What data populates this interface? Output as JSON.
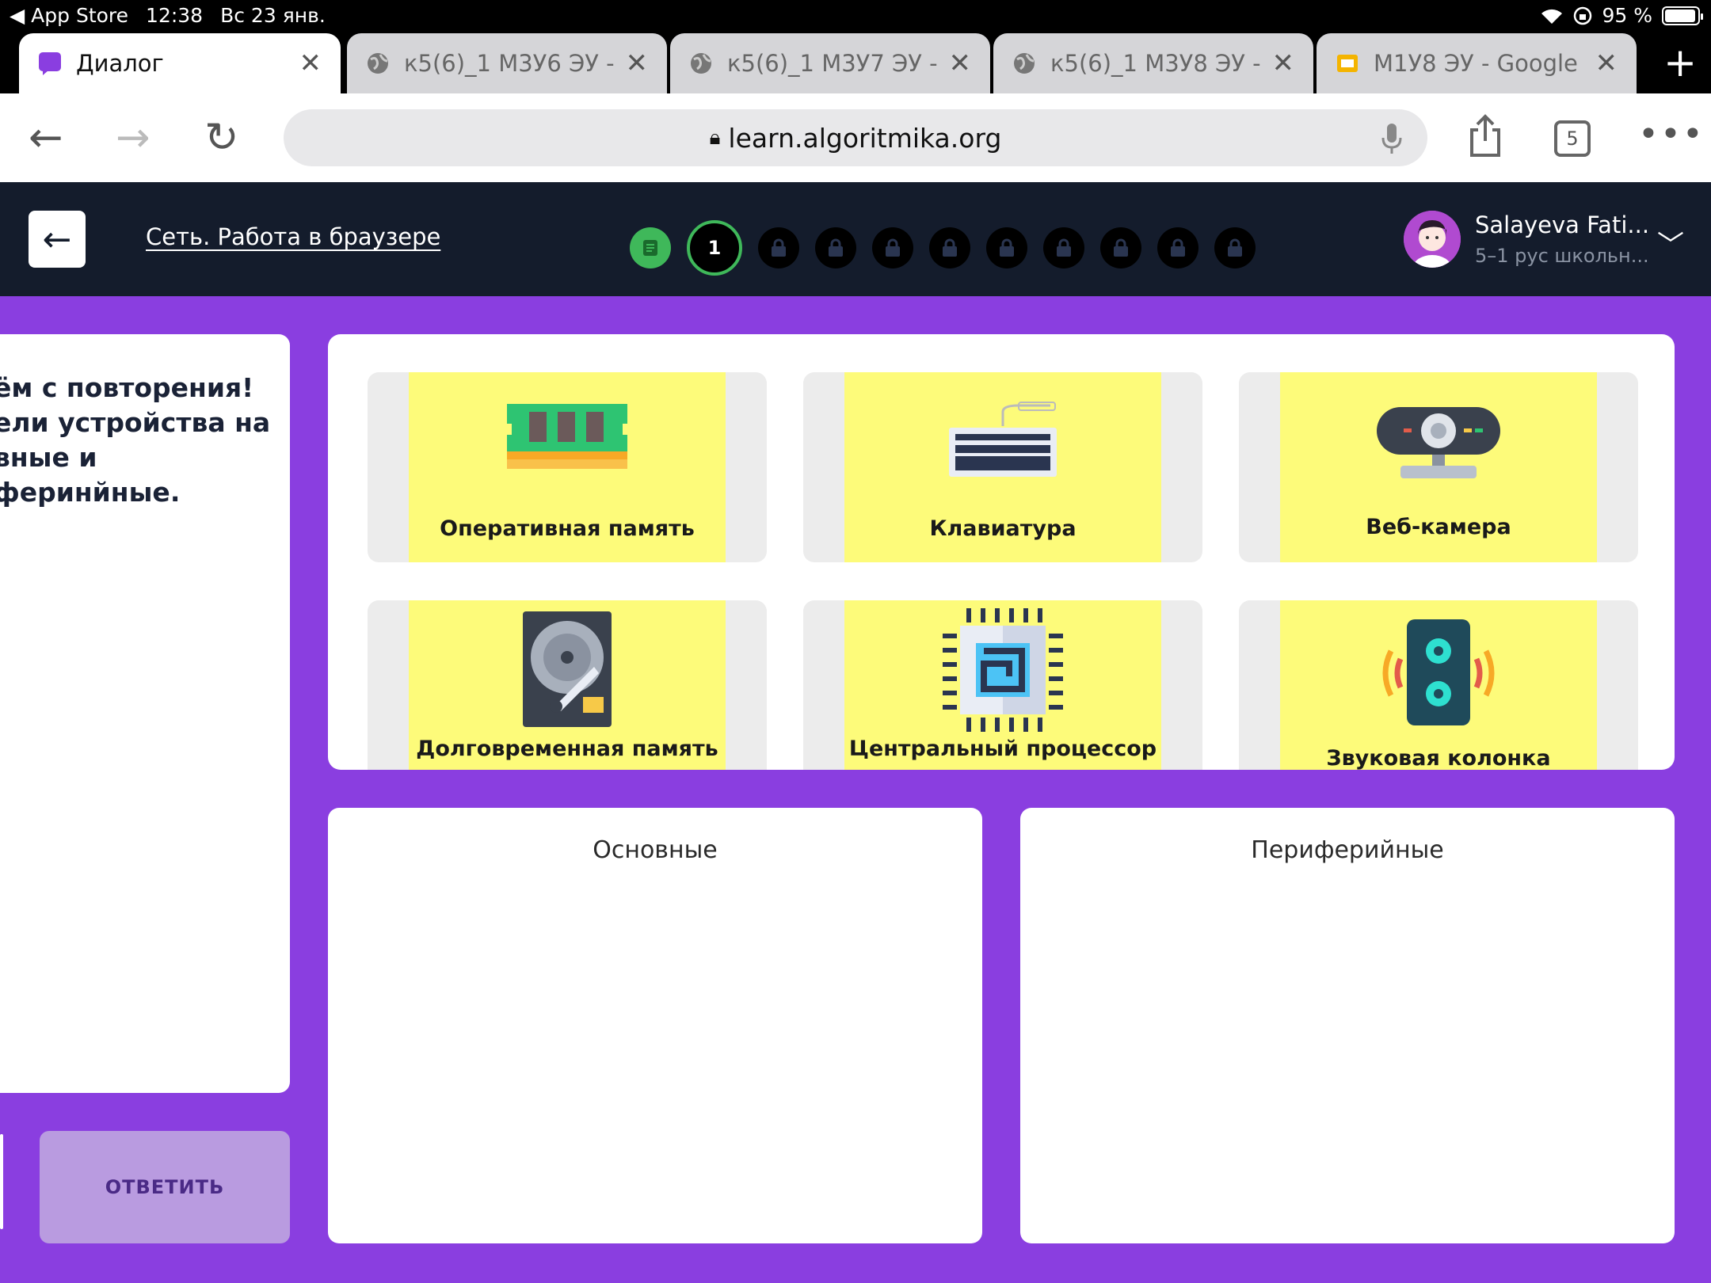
{
  "status": {
    "back_app": "◀ App Store",
    "time": "12:38",
    "date": "Вс 23 янв.",
    "battery": "95 %"
  },
  "tabs": [
    {
      "title": "Диалог",
      "active": true
    },
    {
      "title": "к5(6)_1 М3У6 ЭУ - С"
    },
    {
      "title": "к5(6)_1 М3У7 ЭУ - С"
    },
    {
      "title": "к5(6)_1 М3У8 ЭУ - С"
    },
    {
      "title": "М1У8 ЭУ - Google П"
    }
  ],
  "browser": {
    "url": "learn.algoritmika.org",
    "tab_count": "5"
  },
  "header": {
    "course": "Сеть. Работа в браузере",
    "current_step": "1",
    "user_name": "Salayeva Fati...",
    "user_group": "5–1 рус школьн..."
  },
  "question": {
    "lines": [
      "ём с повторения!",
      "ели устройства на",
      "вные и",
      "феринйные."
    ]
  },
  "answer_label": "ОТВЕТИТЬ",
  "cards": [
    {
      "label": "Оперативная память",
      "icon": "ram-icon"
    },
    {
      "label": "Клавиатура",
      "icon": "keyboard-icon"
    },
    {
      "label": "Веб-камера",
      "icon": "webcam-icon"
    },
    {
      "label": "Долговременная память",
      "icon": "hdd-icon"
    },
    {
      "label": "Центральный процессор",
      "icon": "cpu-icon"
    },
    {
      "label": "Звуковая колонка",
      "icon": "speaker-icon"
    }
  ],
  "drop_zones": {
    "main": "Основные",
    "peripheral": "Периферийные"
  },
  "colors": {
    "accent": "#8a3ee0",
    "header": "#141c2c",
    "card": "#fdfb7a",
    "success": "#3fb85a"
  }
}
